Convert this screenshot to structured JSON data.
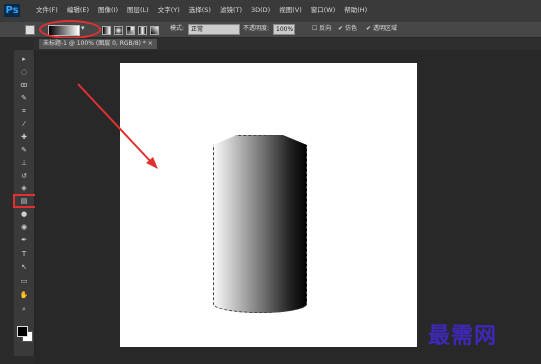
{
  "app": {
    "logo": "Ps"
  },
  "menu": [
    "文件(F)",
    "编辑(E)",
    "图像(I)",
    "图层(L)",
    "文字(Y)",
    "选择(S)",
    "滤镜(T)",
    "3D(D)",
    "视图(V)",
    "窗口(W)",
    "帮助(H)"
  ],
  "options": {
    "dropdown_arrow": "▾",
    "mode_label": "模式:",
    "mode_value": "正常",
    "opacity_label": "不透明度:",
    "opacity_value": "100%",
    "reverse_label": "反向",
    "dither_label": "仿色",
    "transparency_label": "透明区域"
  },
  "document": {
    "tab_title": "未标题-1 @ 100% (图层 0, RGB/8) *"
  },
  "tools": [
    "move-icon",
    "marquee-icon",
    "lasso-icon",
    "quick-select-icon",
    "crop-icon",
    "eyedropper-icon",
    "healing-icon",
    "brush-icon",
    "stamp-icon",
    "history-brush-icon",
    "eraser-icon",
    "gradient-icon",
    "blur-icon",
    "dodge-icon",
    "pen-icon",
    "type-icon",
    "path-select-icon",
    "shape-icon",
    "hand-icon",
    "zoom-icon"
  ],
  "tool_glyphs": [
    "▸",
    "◌",
    "ꝏ",
    "✎",
    "⌗",
    "⁄",
    "✚",
    "✎",
    "⊥",
    "↺",
    "◈",
    "▤",
    "●",
    "◉",
    "✒",
    "T",
    "↖",
    "▭",
    "✋",
    "⌕"
  ],
  "watermark": "最需网",
  "colors": {
    "accent_red": "#e23030",
    "foreground": "#000000",
    "background": "#ffffff"
  }
}
